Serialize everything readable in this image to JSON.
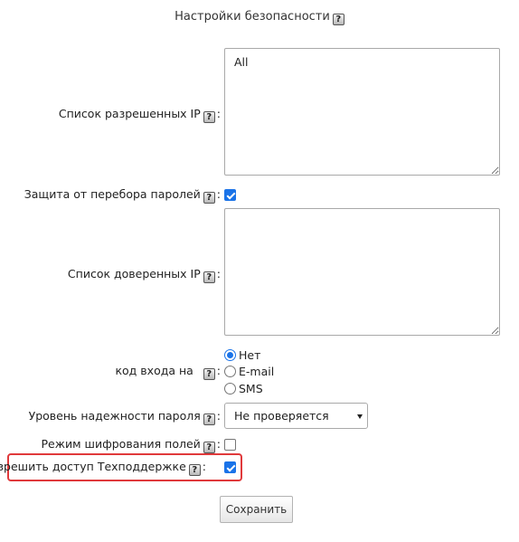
{
  "header": {
    "title": "Настройки безопасности",
    "help_glyph": "?"
  },
  "fields": {
    "allowed_ip": {
      "label": "Список разрешенных IP",
      "value": "All"
    },
    "brute_force": {
      "label": "Защита от перебора паролей",
      "checked": true
    },
    "trusted_ip": {
      "label": "Список доверенных IP",
      "value": ""
    },
    "login_code": {
      "label": "код входа на",
      "options": [
        "Нет",
        "E-mail",
        "SMS"
      ],
      "selected": "Нет"
    },
    "password_strength": {
      "label": "Уровень надежности пароля",
      "selected": "Не проверяется"
    },
    "field_encryption": {
      "label": "Режим шифрования полей",
      "checked": false
    },
    "support_access": {
      "label": "Разрешить доступ Техподдержке",
      "checked": true
    }
  },
  "actions": {
    "save_label": "Сохранить"
  },
  "colors": {
    "accent": "#1a73e8",
    "highlight": "#e0393b"
  },
  "icons": {
    "help": "help-icon",
    "dropdown": "chevron-down-icon",
    "check": "checkmark-icon"
  }
}
